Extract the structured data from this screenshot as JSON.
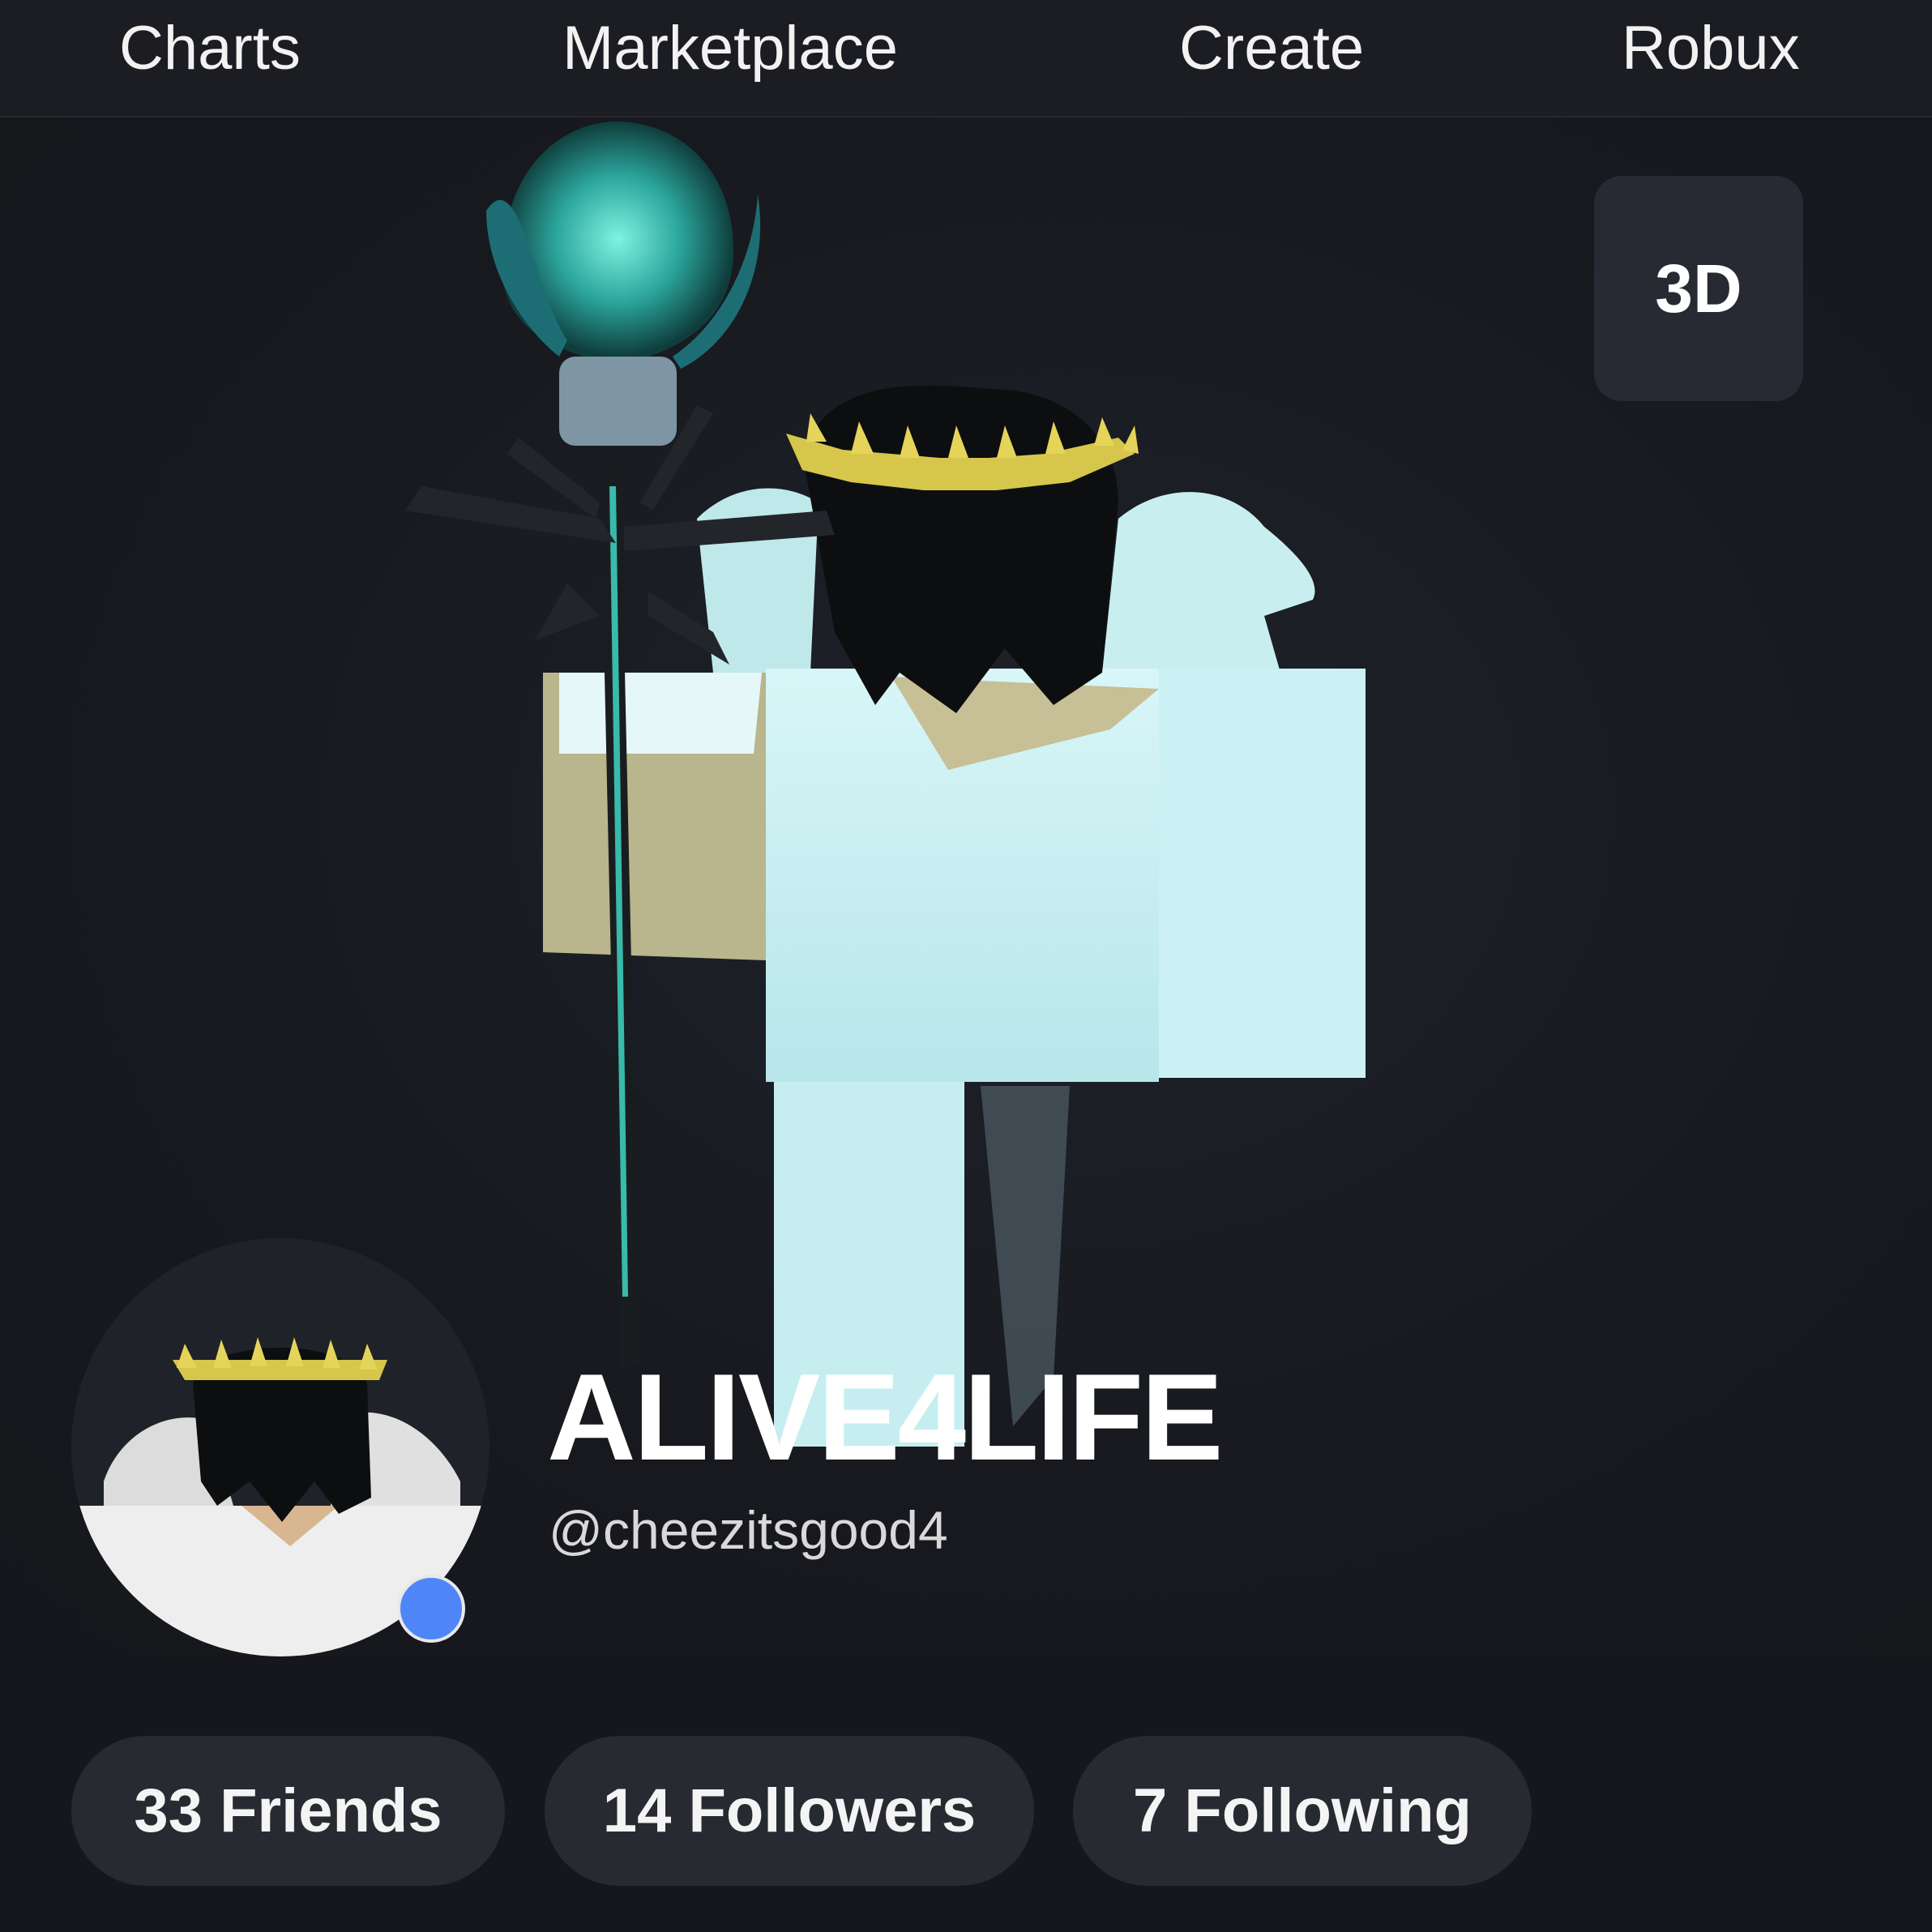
{
  "nav": {
    "items": [
      {
        "label": "Charts"
      },
      {
        "label": "Marketplace"
      },
      {
        "label": "Create"
      },
      {
        "label": "Robux"
      }
    ]
  },
  "viewer": {
    "toggle_label": "3D"
  },
  "profile": {
    "display_name": "ALIVE4LIFE",
    "username": "@cheezitsgood4",
    "online_status_color": "#4f86f7"
  },
  "stats": {
    "friends": "33 Friends",
    "followers": "14 Followers",
    "following": "7 Following"
  },
  "colors": {
    "background": "#15171c",
    "pill": "#272a31",
    "accent_staff": "#3fd6c4",
    "halo": "#d9c84a"
  }
}
